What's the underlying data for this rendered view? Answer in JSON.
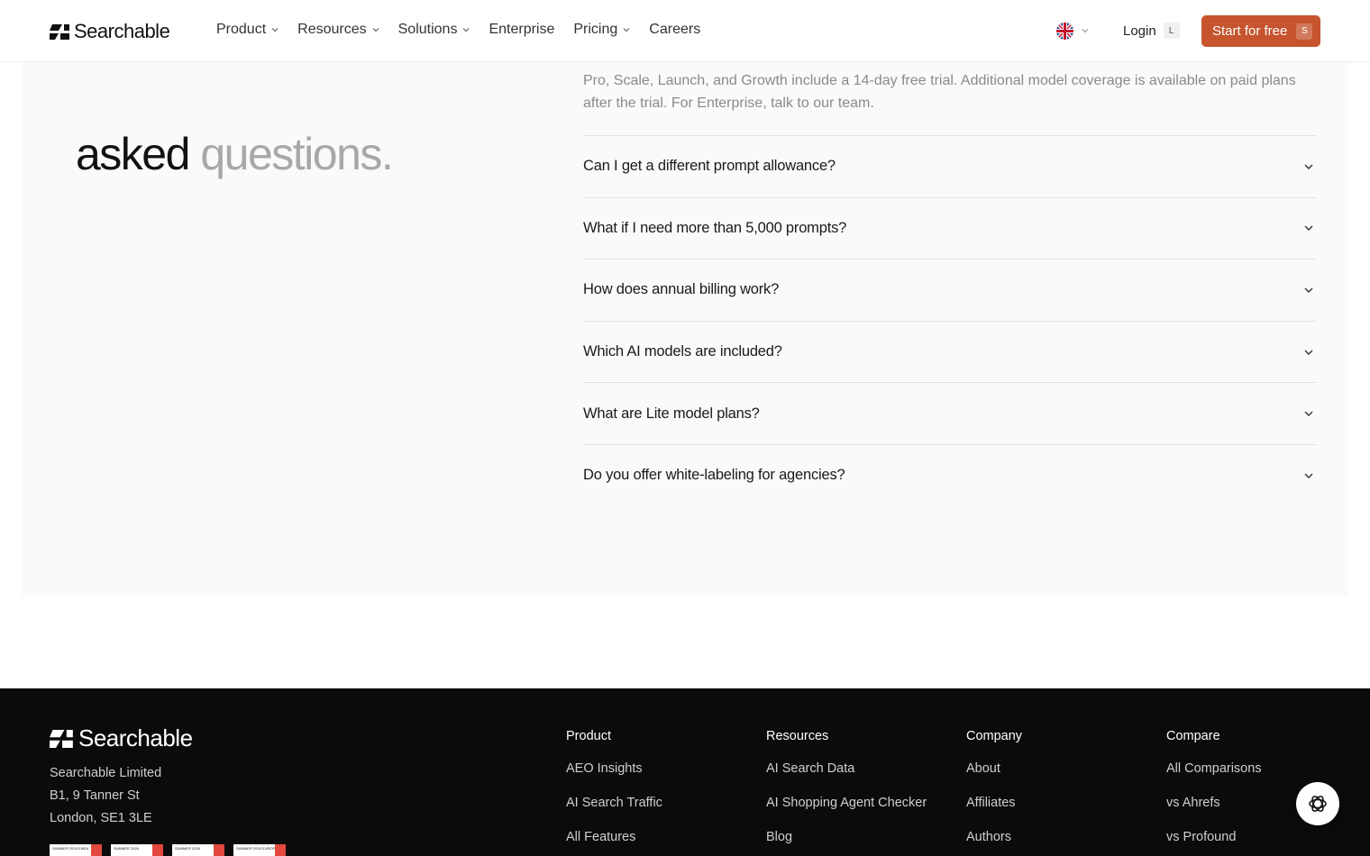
{
  "nav": {
    "brand": "Searchable",
    "links": [
      {
        "label": "Product",
        "dropdown": true
      },
      {
        "label": "Resources",
        "dropdown": true
      },
      {
        "label": "Solutions",
        "dropdown": true
      },
      {
        "label": "Enterprise",
        "dropdown": false
      },
      {
        "label": "Pricing",
        "dropdown": true
      },
      {
        "label": "Careers",
        "dropdown": false
      }
    ],
    "language_icon": "uk-flag-icon",
    "login_label": "Login",
    "login_shortcut": "L",
    "cta_label": "Start for free",
    "cta_shortcut": "S",
    "cta_color": "#c6542d"
  },
  "faq": {
    "heading_dark": "asked",
    "heading_muted": "questions.",
    "open_answer": "Pro, Scale, Launch, and Growth include a 14-day free trial. Additional model coverage is available on paid plans after the trial. For Enterprise, talk to our team.",
    "questions": [
      "Can I get a different prompt allowance?",
      "What if I need more than 5,000 prompts?",
      "How does annual billing work?",
      "Which AI models are included?",
      "What are Lite model plans?",
      "Do you offer white-labeling for agencies?"
    ]
  },
  "footer": {
    "brand": "Searchable",
    "address": [
      "Searchable Limited",
      "B1, 9 Tanner St",
      "London, SE1 3LE"
    ],
    "badges": [
      "SUMMER 2026 EMEA",
      "SUMMER 2026",
      "SUMMER 2026",
      "SUMMER 2026 EUROPE"
    ],
    "columns": [
      {
        "title": "Product",
        "links": [
          "AEO Insights",
          "AI Search Traffic",
          "All Features"
        ]
      },
      {
        "title": "Resources",
        "links": [
          "AI Search Data",
          "AI Shopping Agent Checker",
          "Blog"
        ]
      },
      {
        "title": "Company",
        "links": [
          "About",
          "Affiliates",
          "Authors"
        ]
      },
      {
        "title": "Compare",
        "links": [
          "All Comparisons",
          "vs Ahrefs",
          "vs Profound"
        ]
      }
    ],
    "chat_icon": "openai-chat-icon"
  }
}
